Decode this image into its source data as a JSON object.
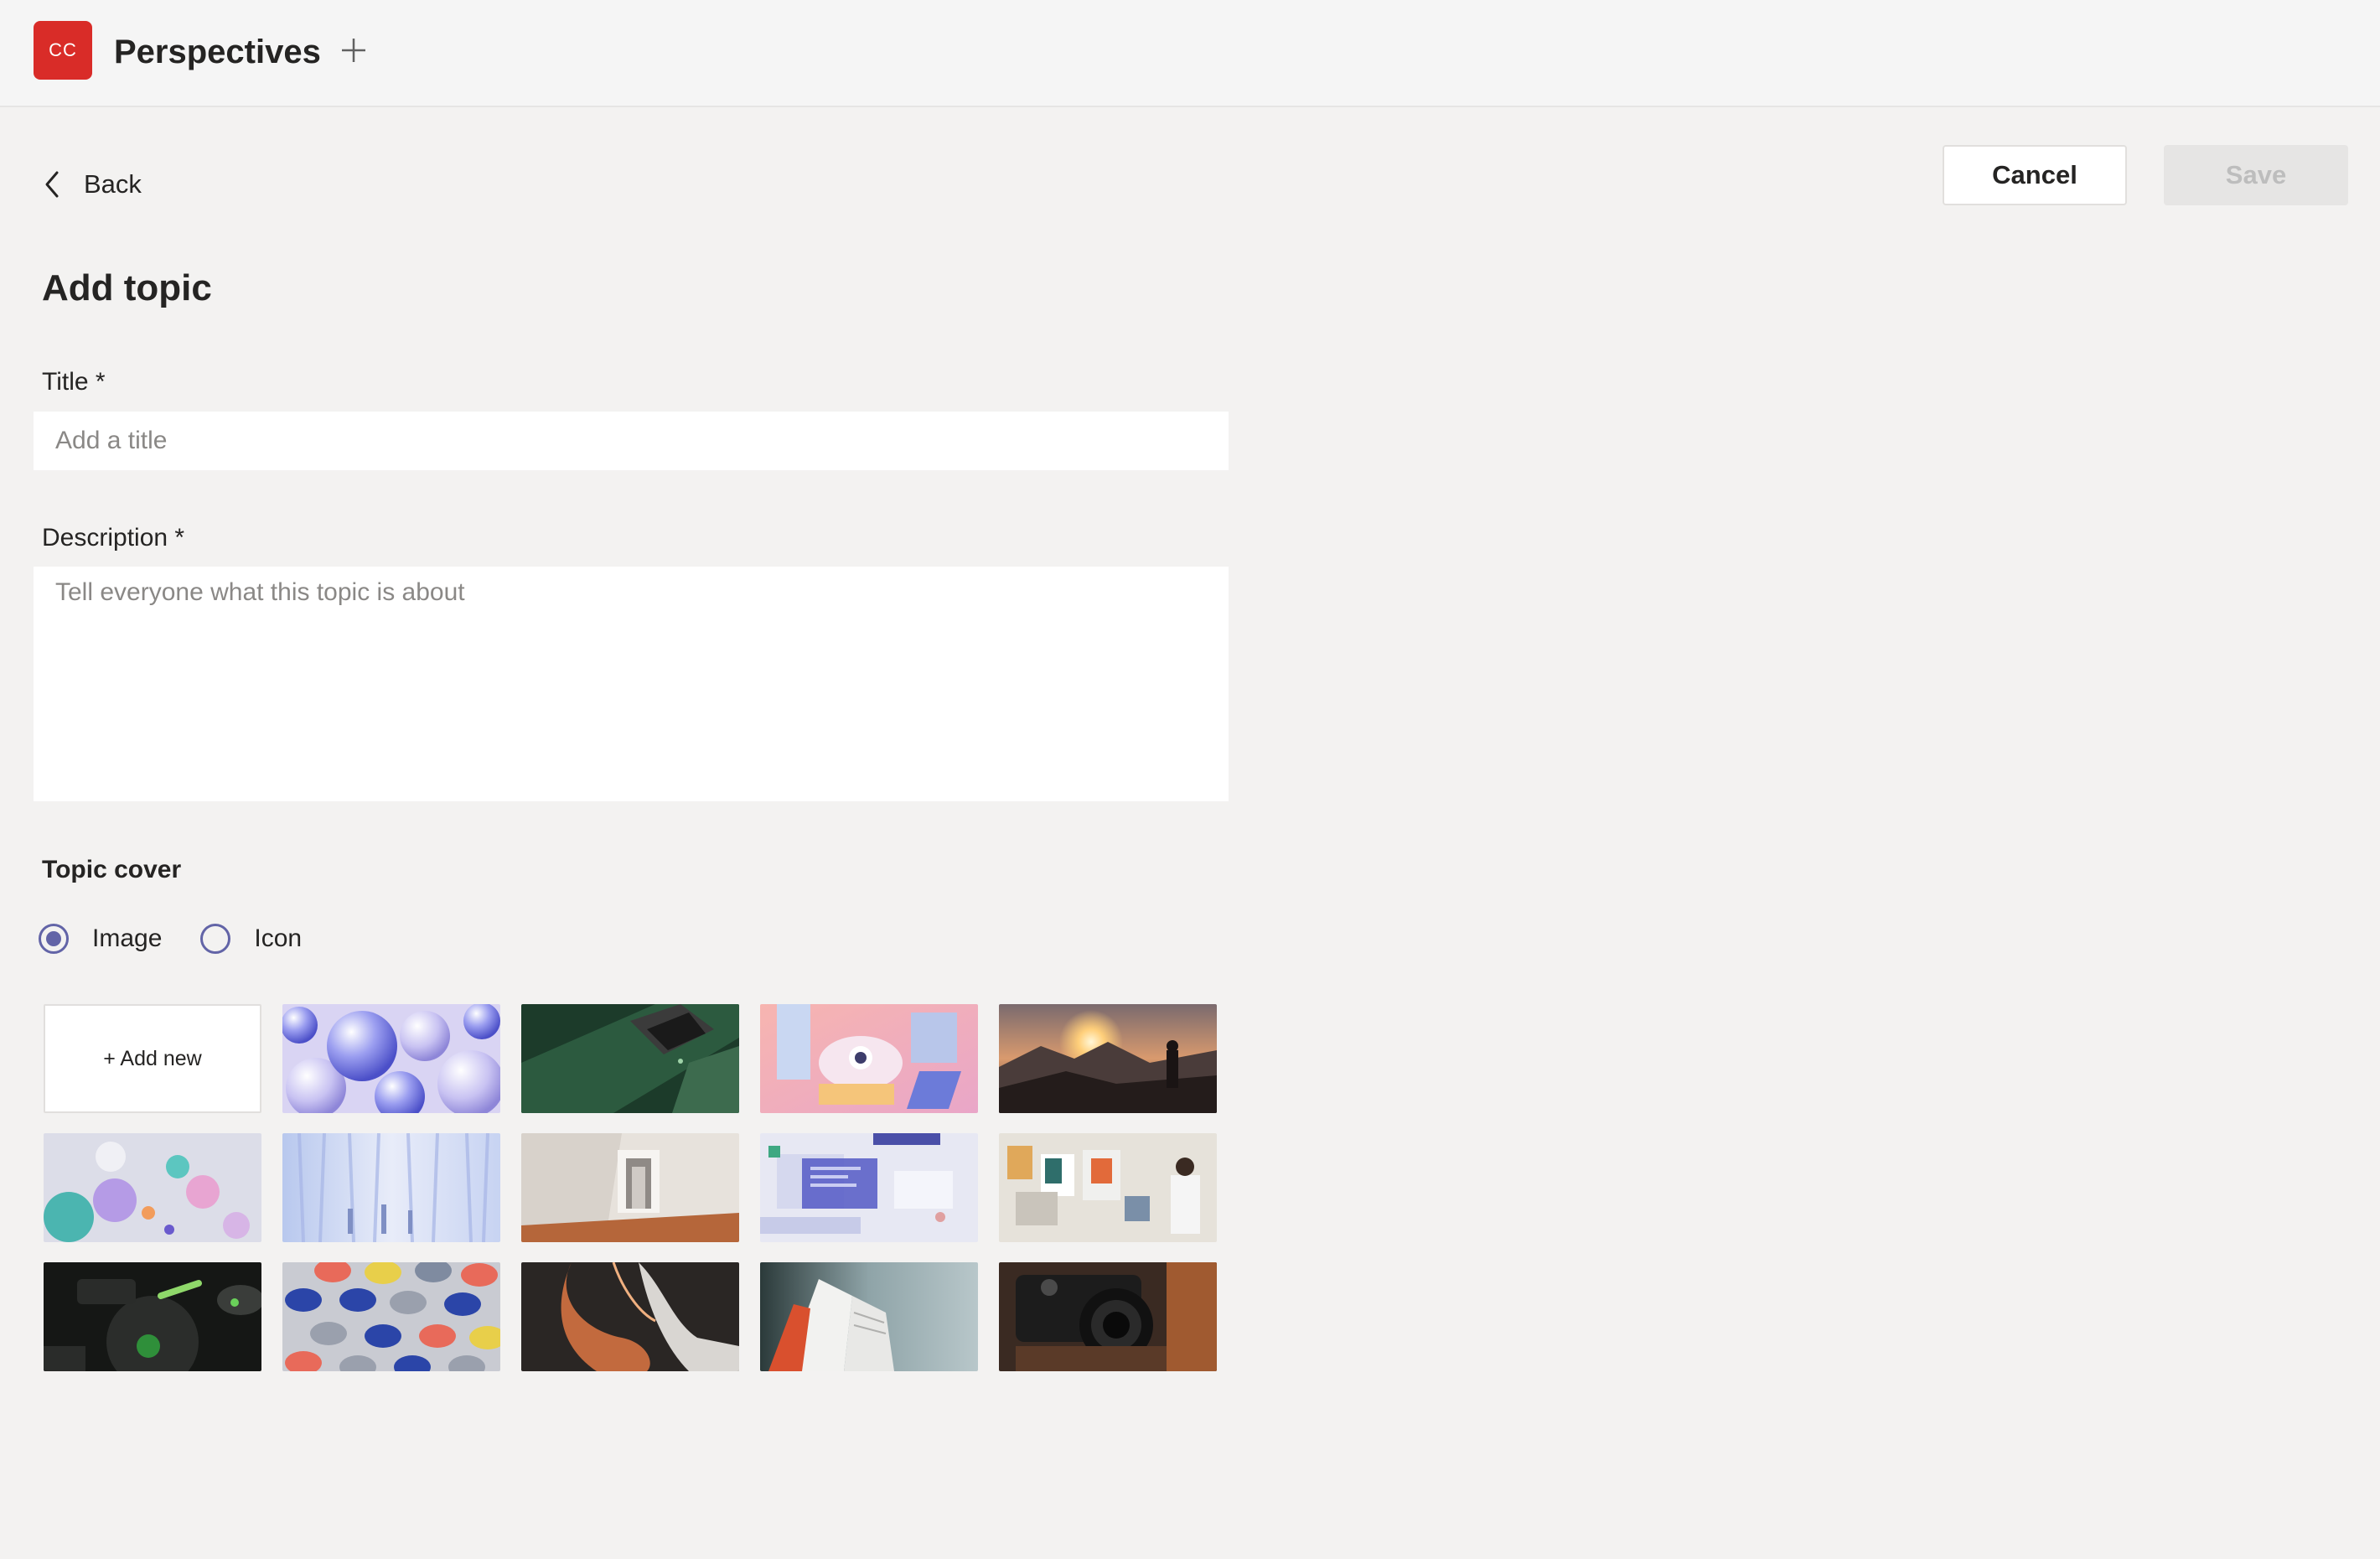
{
  "app": {
    "logo_text": "CC",
    "name": "Perspectives",
    "logo_color": "#d92c28"
  },
  "nav": {
    "back_label": "Back"
  },
  "actions": {
    "cancel_label": "Cancel",
    "save_label": "Save"
  },
  "form": {
    "page_title": "Add topic",
    "title_label": "Title *",
    "title_placeholder": "Add a title",
    "title_value": "",
    "description_label": "Description *",
    "description_placeholder": "Tell everyone what this topic is about",
    "description_value": ""
  },
  "cover": {
    "section_label": "Topic cover",
    "options": [
      {
        "label": "Image",
        "selected": true
      },
      {
        "label": "Icon",
        "selected": false
      }
    ],
    "add_new_label": "+ Add new",
    "accent_color": "#6264a7",
    "images": [
      "purple-spheres",
      "green-geometric",
      "pastel-architecture",
      "mountain-sunset-hiker",
      "floating-balls",
      "blue-curtains-figures",
      "white-doorway-interior",
      "ui-screens-collage",
      "artist-wall-studio",
      "dark-green-abstract",
      "colored-cups-pattern",
      "dark-office-chairs",
      "open-book-closeup",
      "vintage-camera"
    ]
  }
}
